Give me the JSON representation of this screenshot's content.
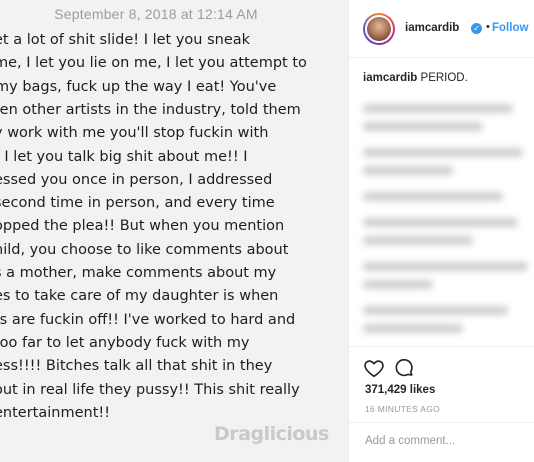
{
  "note": {
    "date": "September 8, 2018 at 12:14 AM",
    "lines": [
      "et a lot of shit slide! I let you sneak",
      "me, I let you lie on me, I let you attempt to",
      "my bags, fuck up the way I eat! You've",
      "ten other artists in the industry, told them",
      "y work with me you'll stop fuckin with",
      "! I let you talk big shit about me!! I",
      "essed you once in person, I addressed",
      "second time in person, and every time",
      "opped the plea!! But when you mention",
      "hild, you choose to like comments about",
      "s a mother, make comments about my",
      "es to take care of my daughter is when",
      "ts are fuckin off!! I've worked to hard and",
      "too far to let anybody fuck with my",
      "ess!!!! Bitches talk all that shit in they",
      "out in real life they pussy!! This shit really",
      "entertainment!!"
    ],
    "watermark": "Draglicious"
  },
  "post": {
    "username": "iamcardib",
    "verified_symbol": "✓",
    "separator": "•",
    "follow_label": "Follow",
    "caption_user": "iamcardib",
    "caption_text": " PERIOD.",
    "likes": "371,429 likes",
    "timestamp": "16 MINUTES AGO",
    "comment_placeholder": "Add a comment...",
    "icons": [
      "heart-icon",
      "comment-icon"
    ],
    "colors": {
      "link": "#3897f0",
      "text": "#262626",
      "muted": "#999999"
    }
  }
}
